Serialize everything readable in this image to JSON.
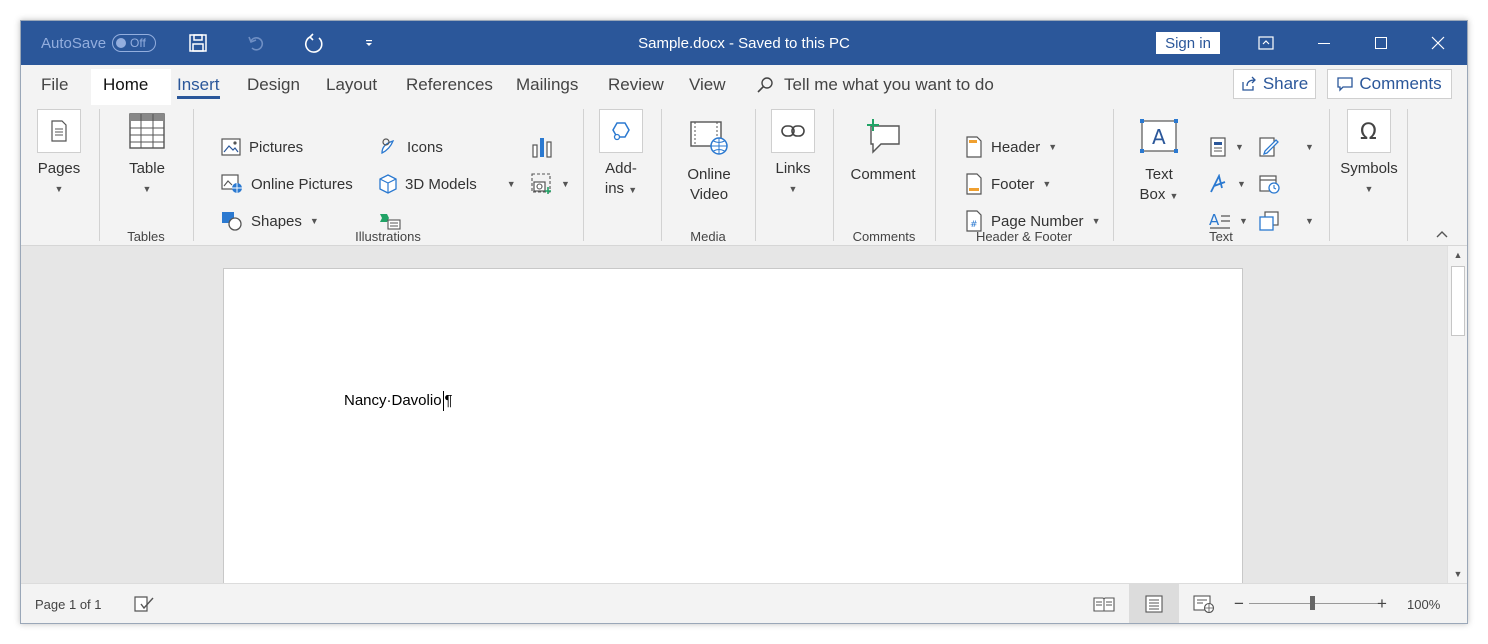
{
  "titlebar": {
    "autosave_label": "AutoSave",
    "autosave_state": "Off",
    "doc_title": "Sample.docx  -  Saved to this PC",
    "signin_label": "Sign in",
    "quick_access_icons": [
      "save-icon",
      "undo-icon",
      "redo-icon",
      "customize-icon"
    ],
    "window_icons": [
      "ribbon-display-icon",
      "minimize-icon",
      "maximize-icon",
      "close-icon"
    ]
  },
  "tabs": [
    "File",
    "Home",
    "Insert",
    "Design",
    "Layout",
    "References",
    "Mailings",
    "Review",
    "View"
  ],
  "active_tab": "Insert",
  "tell_me": "Tell me what you want to do",
  "share_label": "Share",
  "comments_label": "Comments",
  "ribbon": {
    "pages": "Pages",
    "table": "Table",
    "tables_group": "Tables",
    "pictures": "Pictures",
    "online_pictures": "Online Pictures",
    "shapes": "Shapes",
    "icons": "Icons",
    "models_3d": "3D Models",
    "illustrations_group": "Illustrations",
    "addins_1": "Add-",
    "addins_2": "ins",
    "online_video_1": "Online",
    "online_video_2": "Video",
    "media_group": "Media",
    "links": "Links",
    "comment": "Comment",
    "comments_group": "Comments",
    "header": "Header",
    "footer": "Footer",
    "page_number": "Page Number",
    "header_footer_group": "Header & Footer",
    "text_box_1": "Text",
    "text_box_2": "Box",
    "text_group": "Text",
    "symbols": "Symbols"
  },
  "document": {
    "text_before_cursor": "Nancy·Davolio",
    "paragraph_mark": "¶"
  },
  "status": {
    "page": "Page 1 of 1",
    "zoom": "100%",
    "zoom_minus": "−",
    "zoom_plus": "+"
  },
  "colors": {
    "accent": "#2b579a",
    "green": "#21a366"
  }
}
